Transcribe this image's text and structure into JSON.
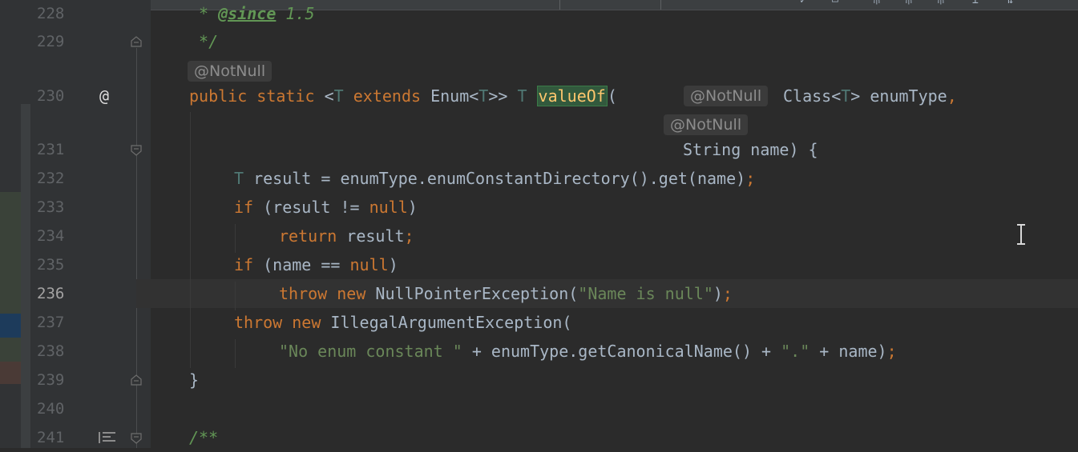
{
  "gutter": {
    "line_numbers": [
      {
        "n": "228",
        "active": false
      },
      {
        "n": "229",
        "active": false
      },
      {
        "n": "230",
        "active": false
      },
      {
        "n": "231",
        "active": false
      },
      {
        "n": "232",
        "active": false
      },
      {
        "n": "233",
        "active": false
      },
      {
        "n": "234",
        "active": false
      },
      {
        "n": "235",
        "active": false
      },
      {
        "n": "236",
        "active": true
      },
      {
        "n": "237",
        "active": false
      },
      {
        "n": "238",
        "active": false
      },
      {
        "n": "239",
        "active": false
      },
      {
        "n": "240",
        "active": false
      },
      {
        "n": "241",
        "active": false
      }
    ],
    "at_marker": "@"
  },
  "inlay_hints": {
    "annotation_above": "@NotNull",
    "param1": "@NotNull",
    "param2": "@NotNull"
  },
  "code": {
    "l228": {
      "star": " * ",
      "tag": "@since",
      "rest": " 1.5"
    },
    "l229": " */",
    "l230": {
      "kw1": "public",
      "kw2": "static",
      "p1": " <",
      "t1": "T",
      "kw3": "extends",
      "p2": " Enum<",
      "t2": "T",
      "p3": ">> ",
      "t3": "T",
      "method": "valueOf",
      "p4": "(",
      "cls": "Class<",
      "t4": "T",
      "p5": "> enumType",
      "comma": ","
    },
    "l231": "String name) {",
    "l232": {
      "t": "T",
      "rest": " result = enumType.enumConstantDirectory().get(name)",
      "semi": ";"
    },
    "l233": {
      "kw": "if",
      "a": " (result != ",
      "null_kw": "null",
      "b": ")"
    },
    "l234": {
      "kw": "return",
      "rest": " result",
      "semi": ";"
    },
    "l235": {
      "kw": "if",
      "a": " (name == ",
      "null_kw": "null",
      "b": ")"
    },
    "l236": {
      "kw1": "throw",
      "kw2": "new",
      "a": " NullPointerException(",
      "str": "\"Name is null\"",
      "b": ")",
      "semi": ";"
    },
    "l237": {
      "kw1": "throw",
      "kw2": "new",
      "a": " IllegalArgumentException("
    },
    "l238": {
      "str1": "\"No enum constant \"",
      "a": " + enumType.getCanonicalName() + ",
      "str2": "\".\"",
      "b": " + name)",
      "semi": ";"
    },
    "l239": "}",
    "l241": "/**"
  },
  "colors": {
    "background": "#2b2b2b",
    "keyword": "#cc7832",
    "string": "#6a8759",
    "doc_comment": "#629755",
    "type_param": "#507874",
    "method_highlight": "#32593d"
  }
}
